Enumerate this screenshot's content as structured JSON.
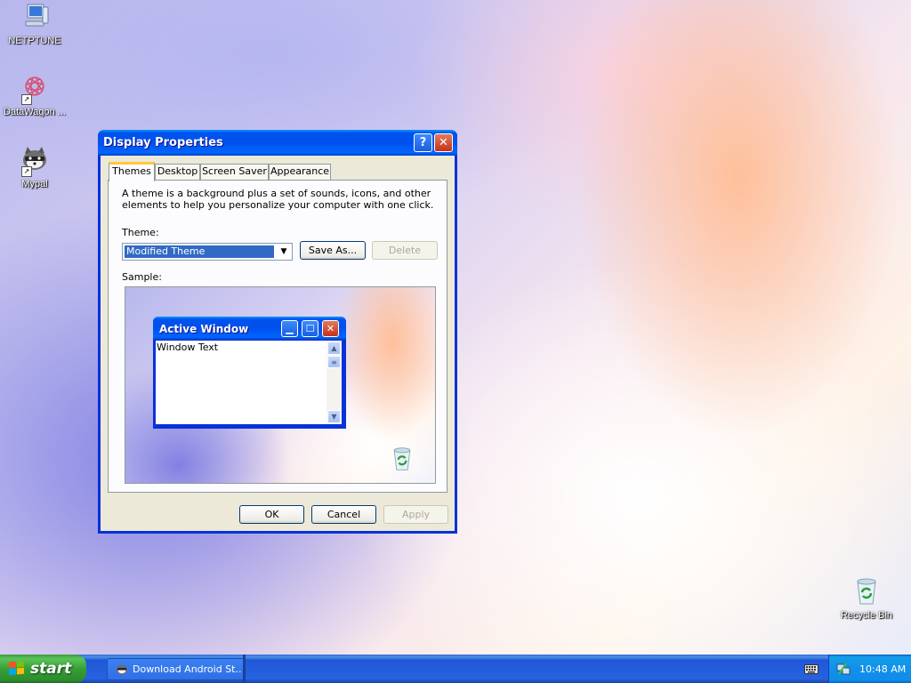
{
  "desktop": {
    "icons": [
      {
        "label": "NETPTUNE",
        "icon": "computer-icon"
      },
      {
        "label": "DataWagon ...",
        "icon": "datawagon-icon"
      },
      {
        "label": "Mypal",
        "icon": "mypal-icon"
      },
      {
        "label": "Recycle Bin",
        "icon": "recycle-bin-icon"
      }
    ]
  },
  "dialog": {
    "title": "Display Properties",
    "help_glyph": "?",
    "close_glyph": "✕",
    "tabs": [
      "Themes",
      "Desktop",
      "Screen Saver",
      "Appearance"
    ],
    "active_tab": "Themes",
    "description": "A theme is a background plus a set of sounds, icons, and other elements to help you personalize your computer with one click.",
    "theme_label": "Theme:",
    "theme_value": "Modified Theme",
    "save_as_label": "Save As...",
    "delete_label": "Delete",
    "sample_label": "Sample:",
    "sample": {
      "window_title": "Active Window",
      "window_text": "Window Text"
    },
    "ok_label": "OK",
    "cancel_label": "Cancel",
    "apply_label": "Apply"
  },
  "taskbar": {
    "start_label": "start",
    "task_item_label": "Download Android St...",
    "clock": "10:48 AM"
  },
  "colors": {
    "title_bar_blue": "#0053ee",
    "start_green": "#34a034",
    "taskbar_blue": "#2663e0",
    "dialog_face": "#ece9d8"
  }
}
